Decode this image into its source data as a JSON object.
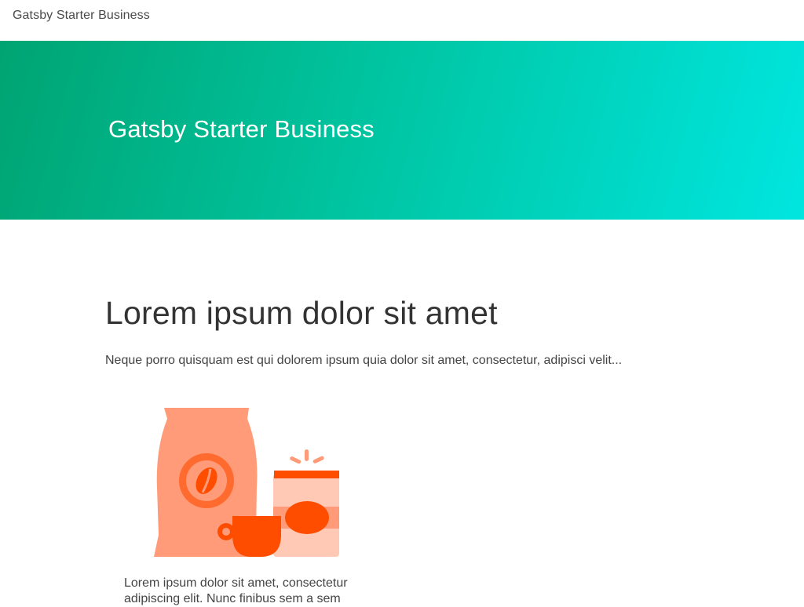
{
  "navbar": {
    "brand": "Gatsby Starter Business"
  },
  "hero": {
    "title": "Gatsby Starter Business",
    "gradient": [
      "#00a472",
      "#00e6e0"
    ]
  },
  "intro": {
    "heading": "Lorem ipsum dolor sit amet",
    "text": "Neque porro quisquam est qui dolorem ipsum quia dolor sit amet, consectetur, adipisci velit..."
  },
  "features": [
    {
      "icon": "coffee-illustration",
      "text": "Lorem ipsum dolor sit amet, consectetur adipiscing elit. Nunc finibus sem a sem"
    }
  ],
  "colors": {
    "accent_orange": "#ff4d00",
    "light_orange": "#ff9b79",
    "pale_orange": "#ffc9b5"
  }
}
